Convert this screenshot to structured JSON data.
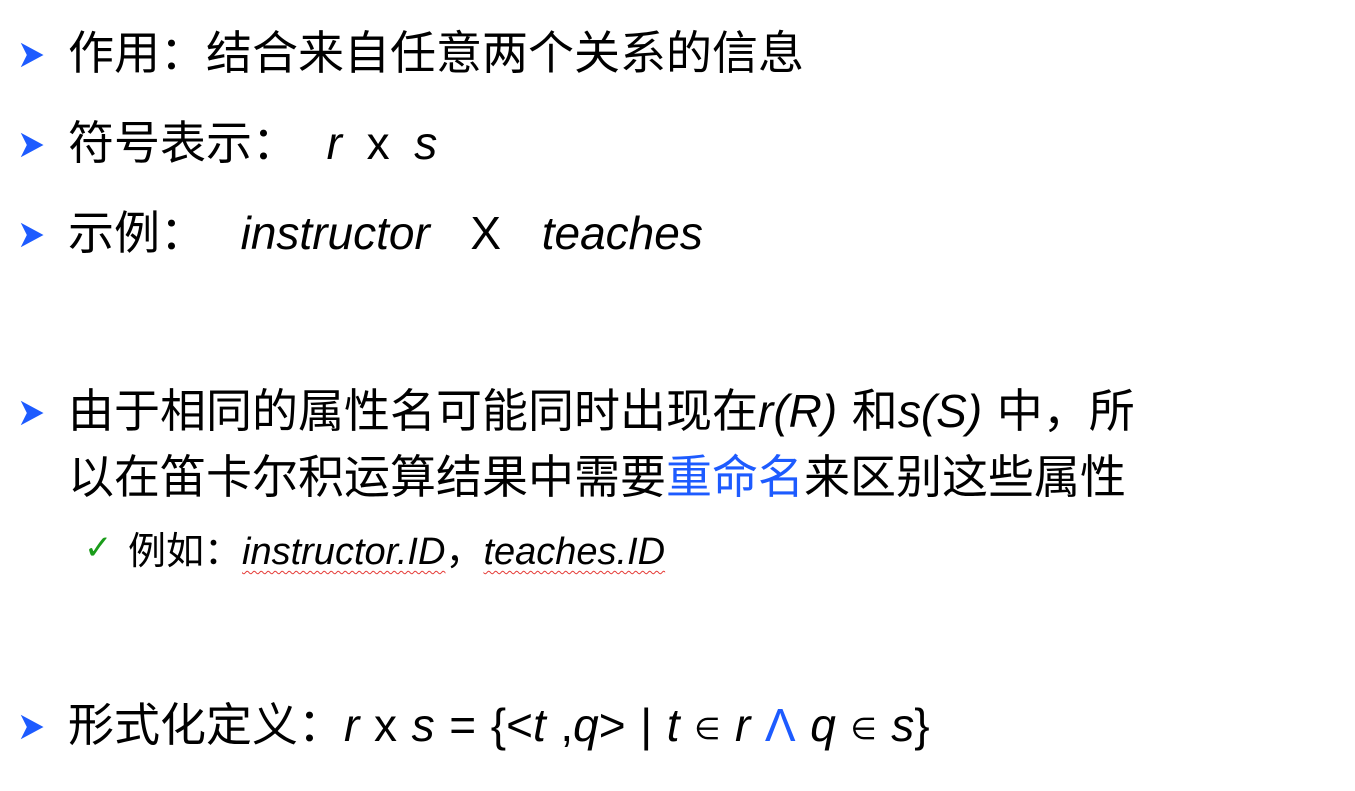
{
  "colors": {
    "bullet": "#1d5bff",
    "text": "#000000",
    "highlight": "#1d5bff",
    "check": "#1a9c1a",
    "spellcheck": "#e53935"
  },
  "line1": {
    "icon": "arrow-bullet-icon",
    "text": "作用：结合来自任意两个关系的信息"
  },
  "line2": {
    "icon": "arrow-bullet-icon",
    "label": "符号表示：",
    "r": "r",
    "x": "x",
    "s": "s"
  },
  "line3": {
    "icon": "arrow-bullet-icon",
    "label": "示例：",
    "left": "instructor",
    "op": "X",
    "right": "teaches"
  },
  "line4": {
    "icon": "arrow-bullet-icon",
    "part1": "由于相同的属性名可能同时出现在",
    "rR": "r(R)",
    "part2": " 和",
    "sS": "s(S)",
    "part3": " 中，所",
    "part4": "以在笛卡尔积运算结果中需要",
    "highlight": "重命名",
    "part5": "来区别这些属性"
  },
  "line5": {
    "icon": "checkmark-icon",
    "check": "✓",
    "label": "例如：",
    "ex1": "instructor.ID",
    "sep": "，",
    "ex2": "teaches.ID"
  },
  "line6": {
    "icon": "arrow-bullet-icon",
    "label": "形式化定义：",
    "r": "r",
    "x": "x",
    "s": "s",
    "eq": "=",
    "open": "{<",
    "t": "t",
    "comma": ",",
    "q": "q",
    "close_angle": ">",
    "bar": "|",
    "t2": "t",
    "in1": "∈",
    "r2": "r",
    "and": "Λ",
    "q2": "q",
    "in2": "∈",
    "s2": "s",
    "close": "}"
  }
}
